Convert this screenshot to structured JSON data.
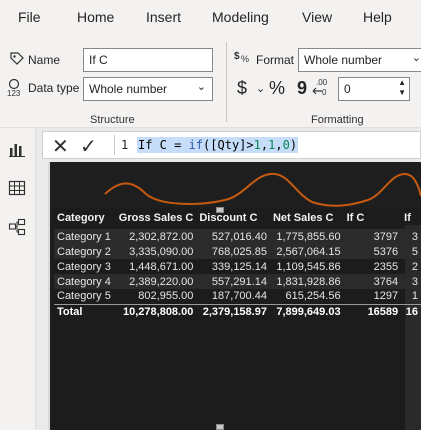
{
  "menu": [
    "File",
    "Home",
    "Insert",
    "Modeling",
    "View",
    "Help"
  ],
  "ribbon": {
    "name_label": "Name",
    "name_value": "If C",
    "datatype_label": "Data type",
    "datatype_value": "Whole number",
    "structure_label": "Structure",
    "format_label": "Format",
    "format_value": "Whole number",
    "currency_symbol": "$",
    "percent_symbol": "%",
    "comma_symbol": "9",
    "decimals_value": "0",
    "formatting_label": "Formatting"
  },
  "formula_bar": {
    "line_number": "1",
    "tokens": {
      "name": "If C",
      "eq": " = ",
      "fn": "if",
      "open": "(",
      "arg": "[Qty]>",
      "n1": "1",
      "c1": ",",
      "n2": "1",
      "c2": ",",
      "n3": "0",
      "close": ")"
    }
  },
  "table": {
    "headers": [
      "Category",
      "Gross Sales C",
      "Discount C",
      "Net Sales C",
      "If C",
      "If"
    ],
    "rows": [
      [
        "Category 1",
        "2,302,872.00",
        "527,016.40",
        "1,775,855.60",
        "3797",
        "3"
      ],
      [
        "Category 2",
        "3,335,090.00",
        "768,025.85",
        "2,567,064.15",
        "5376",
        "5"
      ],
      [
        "Category 3",
        "1,448,671.00",
        "339,125.14",
        "1,109,545.86",
        "2355",
        "2"
      ],
      [
        "Category 4",
        "2,389,220.00",
        "557,291.14",
        "1,831,928.86",
        "3764",
        "3"
      ],
      [
        "Category 5",
        "802,955.00",
        "187,700.44",
        "615,254.56",
        "1297",
        "1"
      ]
    ],
    "total": [
      "Total",
      "10,278,808.00",
      "2,379,158.97",
      "7,899,649.03",
      "16589",
      "16"
    ]
  },
  "colors": {
    "accent_line": "#c55a11",
    "visual_bg": "#1e1e1e"
  }
}
